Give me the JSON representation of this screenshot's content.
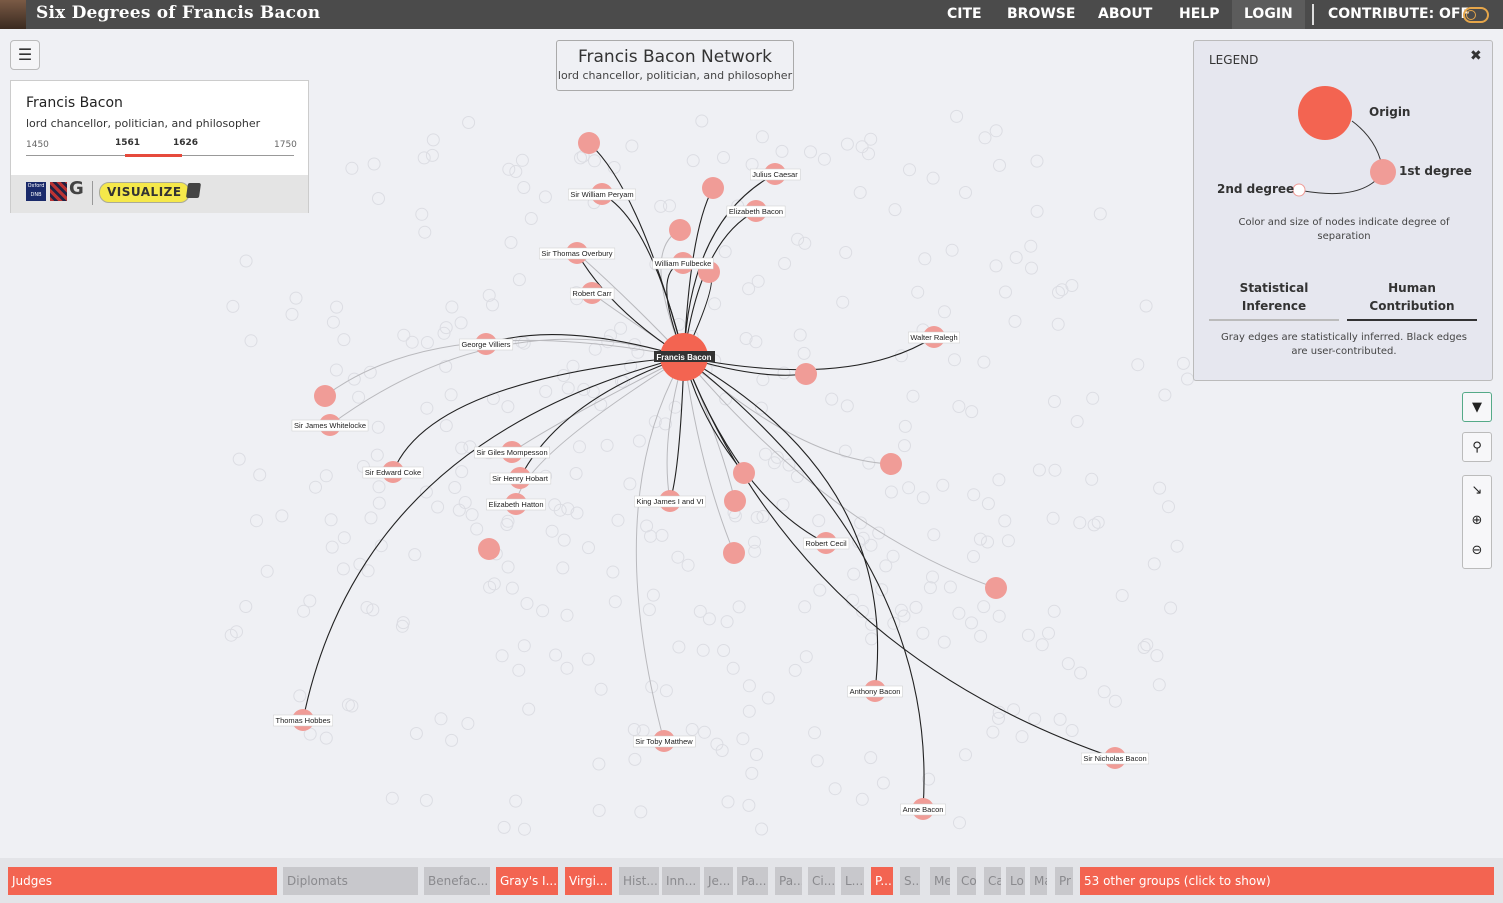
{
  "app": {
    "title": "Six Degrees of Francis Bacon"
  },
  "nav": {
    "cite": "CITE",
    "browse": "BROWSE",
    "about": "ABOUT",
    "help": "HELP",
    "login": "LOGIN",
    "contribute": "CONTRIBUTE: OFF"
  },
  "person": {
    "name": "Francis Bacon",
    "description": "lord chancellor, politician, and philosopher",
    "timeline": {
      "min": "1450",
      "start": "1561",
      "end": "1626",
      "max": "1750"
    },
    "visualize_label": "VISUALIZE",
    "odnb_label": "Oxford DNB"
  },
  "network": {
    "title": "Francis Bacon Network",
    "subtitle": "lord chancellor, politician, and philosopher",
    "origin": "Francis Bacon",
    "nodes": [
      "Sir William Peryam",
      "Julius Caesar",
      "Elizabeth Bacon",
      "Sir Thomas Overbury",
      "William Fulbecke",
      "Robert Carr",
      "George Villiers",
      "Walter Ralegh",
      "Sir James Whitelocke",
      "Sir Edward Coke",
      "Sir Giles Mompesson",
      "Sir Henry Hobart",
      "Elizabeth Hatton",
      "King James I and VI",
      "Robert Cecil",
      "Anthony Bacon",
      "Thomas Hobbes",
      "Sir Toby Matthew",
      "Sir Nicholas Bacon",
      "Anne Bacon"
    ]
  },
  "legend": {
    "heading": "LEGEND",
    "origin": "Origin",
    "first": "1st degree",
    "second": "2nd degree",
    "size_note": "Color and size of nodes indicate degree of separation",
    "tab_stat": "Statistical Inference",
    "tab_human": "Human Contribution",
    "edge_note": "Gray edges are statistically inferred. Black edges are user-contributed."
  },
  "controls": [
    "filter-icon",
    "search-icon",
    "collapse-icon",
    "zoom-in-icon",
    "zoom-out-icon"
  ],
  "groups": [
    {
      "label": "Judges",
      "active": true
    },
    {
      "label": "Diplomats",
      "active": false
    },
    {
      "label": "Benefac...",
      "active": false
    },
    {
      "label": "Gray's I...",
      "active": true
    },
    {
      "label": "Virgi...",
      "active": true
    },
    {
      "label": "Hist...",
      "active": false
    },
    {
      "label": "Inn...",
      "active": false
    },
    {
      "label": "Je...",
      "active": false
    },
    {
      "label": "Pa...",
      "active": false
    },
    {
      "label": "Pa...",
      "active": false
    },
    {
      "label": "Ci...",
      "active": false
    },
    {
      "label": "L...",
      "active": false
    },
    {
      "label": "P...",
      "active": true
    },
    {
      "label": "S...",
      "active": false
    },
    {
      "label": "Me",
      "active": false
    },
    {
      "label": "Co",
      "active": false
    },
    {
      "label": "Ca",
      "active": false
    },
    {
      "label": "Lo",
      "active": false
    },
    {
      "label": "Ma",
      "active": false
    },
    {
      "label": "Pr",
      "active": false
    },
    {
      "label": "53 other groups (click to show)",
      "active": true
    }
  ],
  "colors": {
    "origin": "#f36451",
    "first": "#f09c97",
    "active_group": "#f36451",
    "topbar": "#4b4b4b"
  }
}
